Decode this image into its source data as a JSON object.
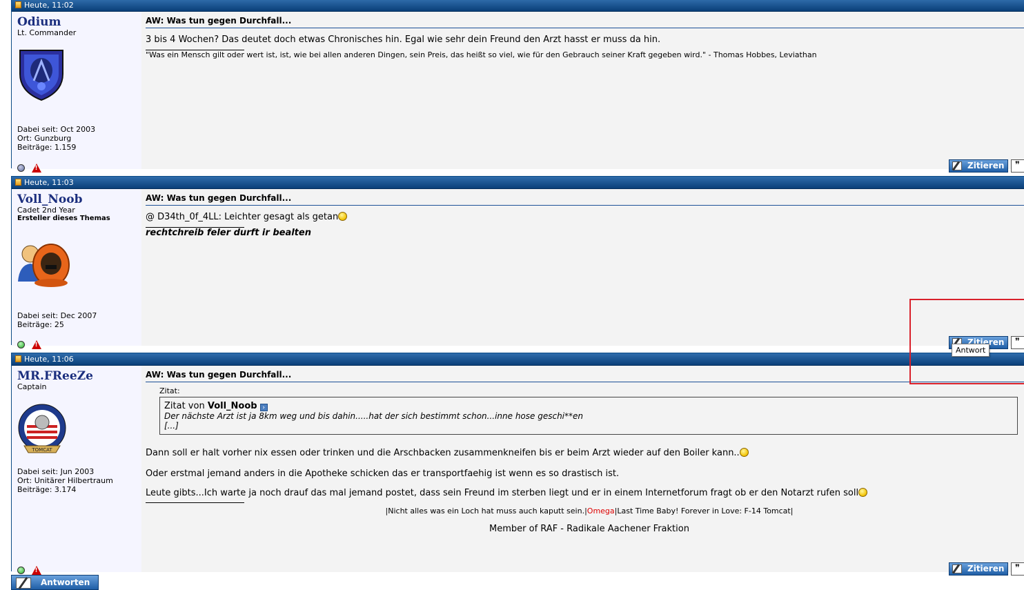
{
  "posts": [
    {
      "date": "Heute, 11:02",
      "hash": "#",
      "username": "Odium",
      "rank": "Lt. Commander",
      "joined": "Dabei seit: Oct 2003",
      "location": "Ort: Gunzburg",
      "posts_count": "Beiträge: 1.159",
      "online_color": "#5a6a9a",
      "title": "AW: Was tun gegen Durchfall...",
      "message": "3 bis 4 Wochen? Das deutet doch etwas Chronisches hin. Egal wie sehr dein Freund den Arzt hasst er muss da hin.",
      "signature": "\"Was ein Mensch gilt oder wert ist, ist, wie bei allen anderen Dingen, sein Preis, das heißt so viel, wie für den Gebrauch seiner Kraft gegeben wird.\" - Thomas Hobbes, Leviathan",
      "quote_btn": "Zitieren"
    },
    {
      "date": "Heute, 11:03",
      "hash": "#",
      "username": "Voll_Noob",
      "rank": "Cadet 2nd Year",
      "starter": "Ersteller dieses Themas",
      "joined": "Dabei seit: Dec 2007",
      "posts_count": "Beiträge: 25",
      "online_color": "#22aa22",
      "title": "AW: Was tun gegen Durchfall...",
      "message": "@ D34th_0f_4LL: Leichter gesagt als getan",
      "signature": "rechtchreib feler durft ir bealten",
      "quote_btn": "Zitieren"
    },
    {
      "date": "Heute, 11:06",
      "hash": "#",
      "username": "MR.FReeZe",
      "rank": "Captain",
      "joined": "Dabei seit: Jun 2003",
      "location": "Ort: Unitärer Hilbertraum",
      "posts_count": "Beiträge: 3.174",
      "online_color": "#22aa22",
      "title": "AW: Was tun gegen Durchfall...",
      "quote_label": "Zitat:",
      "quote_prefix": "Zitat von",
      "quote_author": "Voll_Noob",
      "quote_line1": "Der nächste Arzt ist ja 8km weg und bis dahin.....hat der sich bestimmt schon...inne hose geschi**en",
      "quote_line2": "[...]",
      "line1": "Dann soll er halt vorher nix essen oder trinken und die Arschbacken zusammenkneifen bis er beim Arzt wieder auf den Boiler kann..",
      "line2": "Oder erstmal jemand anders in die Apotheke schicken das er transportfaehig ist wenn es so drastisch ist.",
      "line3": "Leute gibts...Ich warte ja noch drauf das mal jemand postet, dass sein Freund im sterben liegt und er in einem Internetforum fragt ob er den Notarzt rufen soll",
      "sig_part1": "|Nicht alles was ein Loch hat muss auch kaputt sein.|",
      "sig_omega": "Omega",
      "sig_part2": "|Last Time Baby! Forever in Love: F-14 Tomcat|",
      "sig_line2": "Member of RAF - Radikale Aachener Fraktion",
      "quote_btn": "Zitieren"
    }
  ],
  "tooltip": "Antwort",
  "reply_button": "Antworten",
  "colors": {
    "header": "#1f5ea6",
    "username": "#1b2e7e",
    "highlight": "#d9202a"
  }
}
